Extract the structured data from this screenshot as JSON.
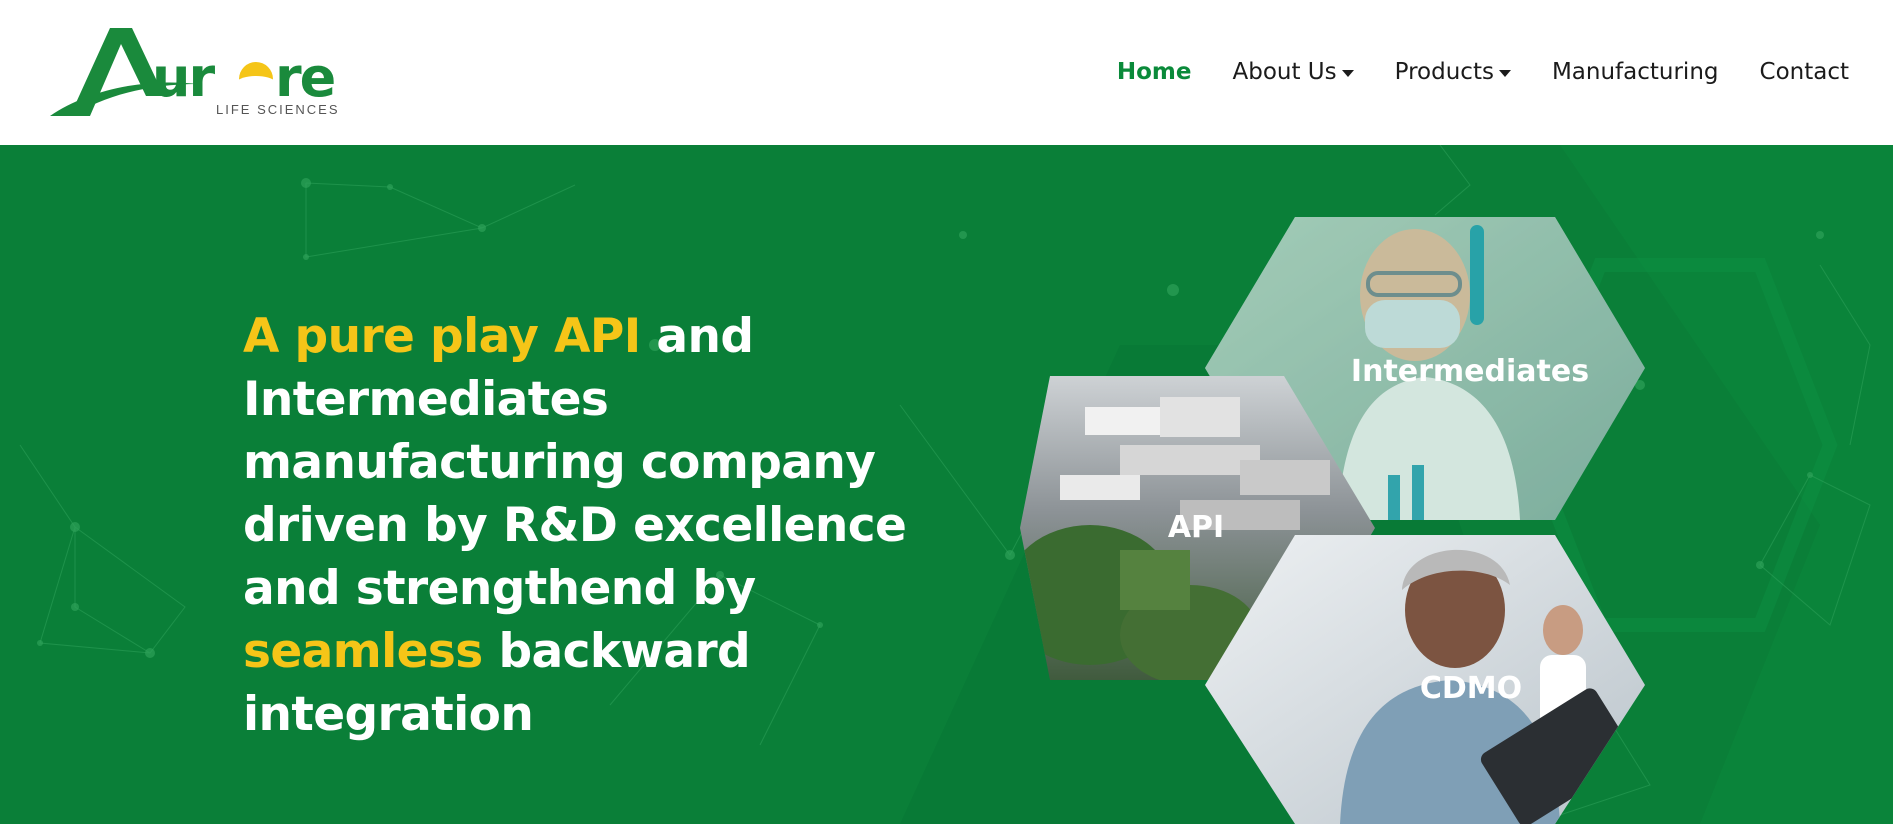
{
  "brand": {
    "name": "Aurore",
    "tagline": "LIFE SCIENCES",
    "green": "#1a8a3c",
    "yellow": "#f5c518"
  },
  "nav": {
    "items": [
      {
        "label": "Home",
        "active": true
      },
      {
        "label": "About Us",
        "dropdown": true
      },
      {
        "label": "Products",
        "dropdown": true
      },
      {
        "label": "Manufacturing"
      },
      {
        "label": "Contact"
      }
    ]
  },
  "hero": {
    "background_color": "#0a7f38",
    "headline": {
      "part1": "A pure play API",
      "part2": " and Intermediates manufacturing company driven by R&D excellence and strengthend by ",
      "part3": "seamless",
      "part4": " backward integration"
    },
    "tiles": [
      {
        "label": "Intermediates",
        "image": "scientist holding test tube"
      },
      {
        "label": "API",
        "image": "aerial view of manufacturing plant"
      },
      {
        "label": "CDMO",
        "image": "woman using tablet"
      }
    ]
  }
}
